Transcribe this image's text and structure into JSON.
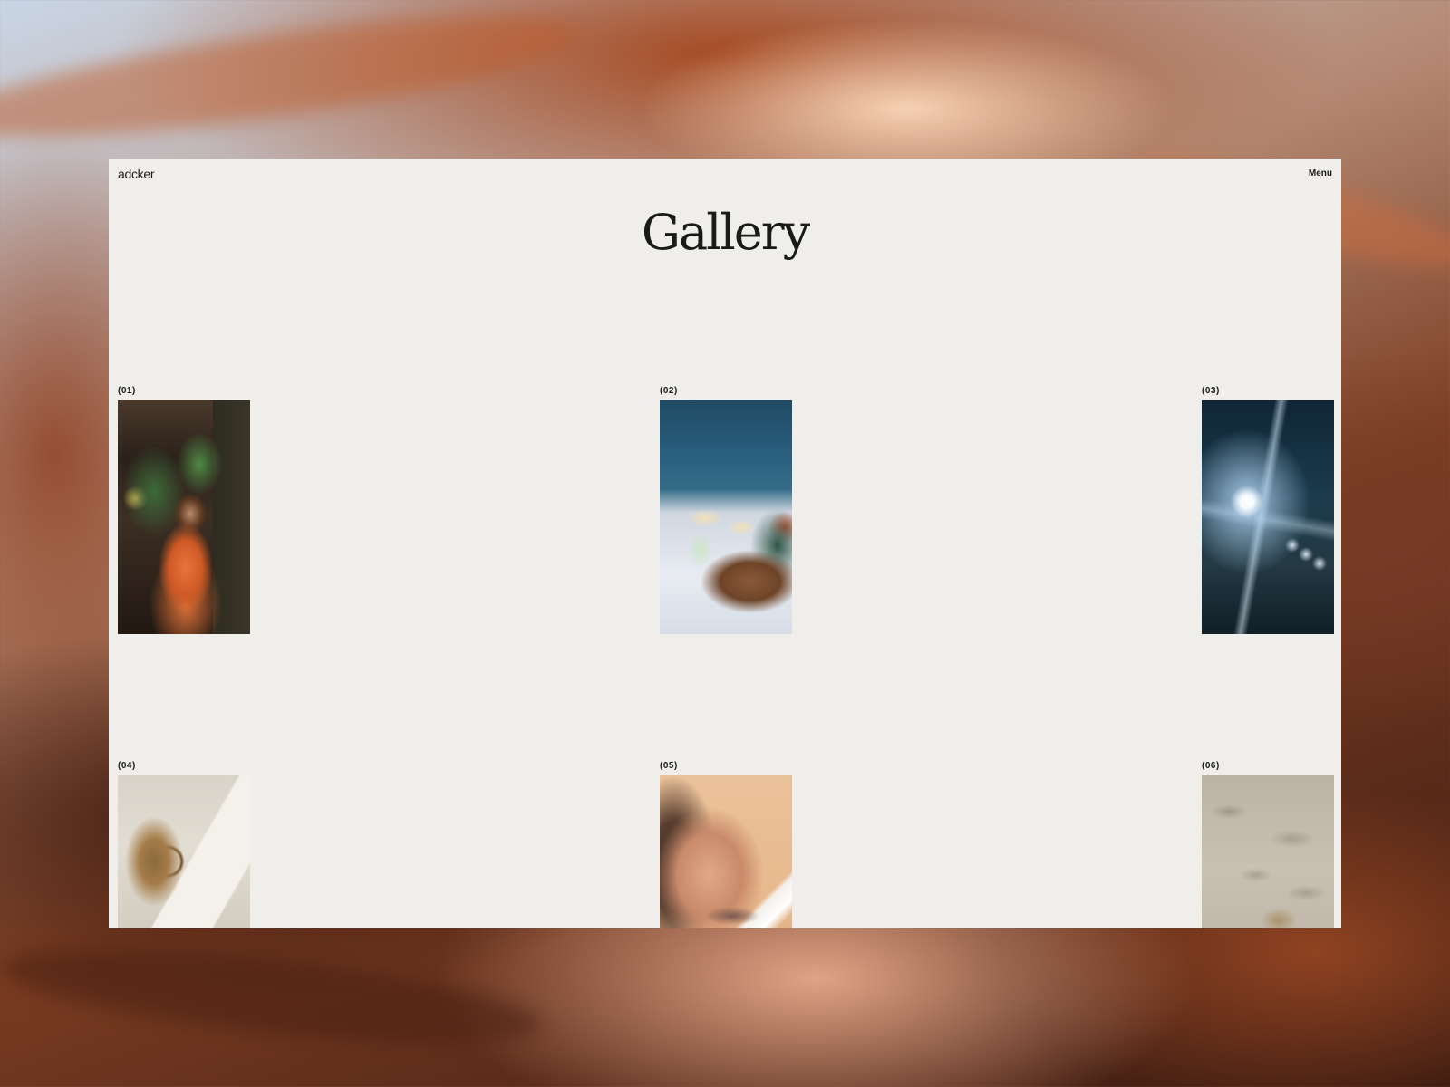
{
  "header": {
    "logo": "adcker",
    "menu_label": "Menu"
  },
  "page": {
    "title": "Gallery"
  },
  "gallery": {
    "items": [
      {
        "index": "(01)",
        "image": "woman-orange-dress-photo"
      },
      {
        "index": "(02)",
        "image": "table-by-sea-photo"
      },
      {
        "index": "(03)",
        "image": "sun-flare-photo"
      },
      {
        "index": "(04)",
        "image": "straw-bag-book-photo"
      },
      {
        "index": "(05)",
        "image": "woman-skincare-portrait-photo"
      },
      {
        "index": "(06)",
        "image": "sand-beach-photo"
      }
    ]
  }
}
